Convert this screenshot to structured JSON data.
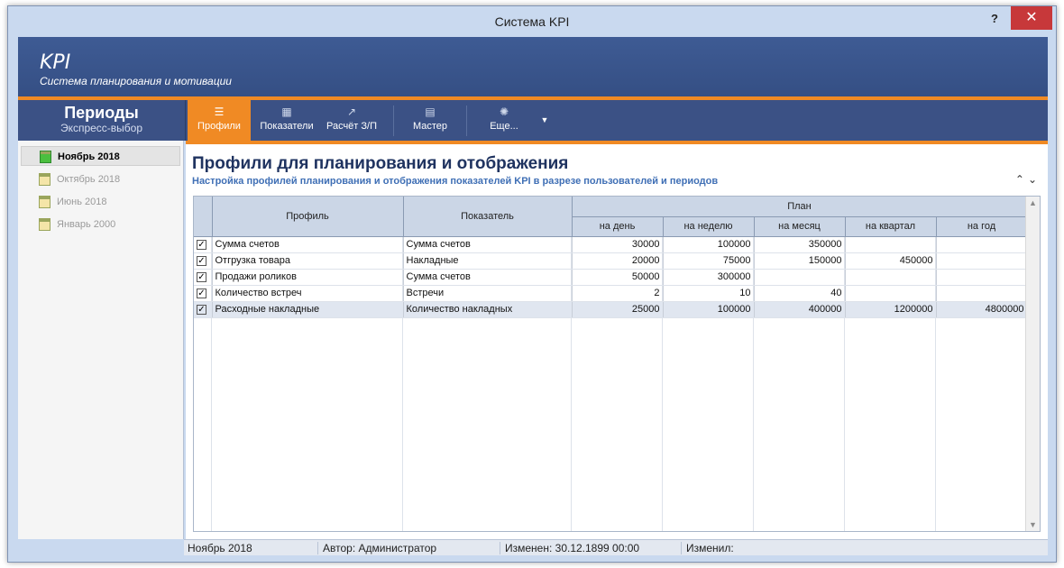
{
  "window": {
    "title": "Система KPI",
    "help": "?",
    "close": "✕"
  },
  "banner": {
    "brand": "KPI",
    "tagline": "Система планирования и мотивации"
  },
  "periods_header": {
    "title": "Периоды",
    "subtitle": "Экспресс-выбор"
  },
  "toolbar": {
    "buttons": [
      {
        "label": "Профили",
        "icon": "profiles-icon",
        "active": true
      },
      {
        "label": "Показатели",
        "icon": "indicators-icon",
        "active": false
      },
      {
        "label": "Расчёт З/П",
        "icon": "salary-calc-icon",
        "active": false
      },
      {
        "label": "Мастер",
        "icon": "wizard-icon",
        "active": false
      },
      {
        "label": "Еще...",
        "icon": "more-icon",
        "active": false
      }
    ],
    "dropdown_arrow": "▼"
  },
  "sidebar": {
    "items": [
      {
        "label": "Ноябрь 2018",
        "selected": true
      },
      {
        "label": "Октябрь 2018",
        "selected": false
      },
      {
        "label": "Июнь 2018",
        "selected": false
      },
      {
        "label": "Январь 2000",
        "selected": false
      }
    ]
  },
  "content": {
    "title": "Профили для планирования и отображения",
    "subtitle": "Настройка профилей планирования и отображения показателей KPI в разрезе пользователей и периодов",
    "collapse_up": "⌃",
    "collapse_down": "⌄"
  },
  "grid": {
    "headers": {
      "profile": "Профиль",
      "indicator": "Показатель",
      "plan": "План",
      "per_day": "на день",
      "per_week": "на неделю",
      "per_month": "на месяц",
      "per_quarter": "на квартал",
      "per_year": "на год"
    },
    "rows": [
      {
        "checked": "✓",
        "profile": "Сумма счетов",
        "indicator": "Сумма счетов",
        "day": "30000",
        "week": "100000",
        "month": "350000",
        "quarter": "",
        "year": ""
      },
      {
        "checked": "✓",
        "profile": "Отгрузка товара",
        "indicator": "Накладные",
        "day": "20000",
        "week": "75000",
        "month": "150000",
        "quarter": "450000",
        "year": ""
      },
      {
        "checked": "✓",
        "profile": "Продажи роликов",
        "indicator": "Сумма счетов",
        "day": "50000",
        "week": "300000",
        "month": "",
        "quarter": "",
        "year": ""
      },
      {
        "checked": "✓",
        "profile": "Количество встреч",
        "indicator": "Встречи",
        "day": "2",
        "week": "10",
        "month": "40",
        "quarter": "",
        "year": ""
      },
      {
        "checked": "✓",
        "profile": "Расходные накладные",
        "indicator": "Количество накладных",
        "day": "25000",
        "week": "100000",
        "month": "400000",
        "quarter": "1200000",
        "year": "4800000"
      }
    ]
  },
  "statusbar": {
    "period": "Ноябрь 2018",
    "author": "Автор: Администратор",
    "changed": "Изменен: 30.12.1899 00:00",
    "changed_by": "Изменил:"
  },
  "colors": {
    "accent": "#f08a24",
    "header_blue": "#3b5185",
    "title_blue": "#1f3360"
  }
}
